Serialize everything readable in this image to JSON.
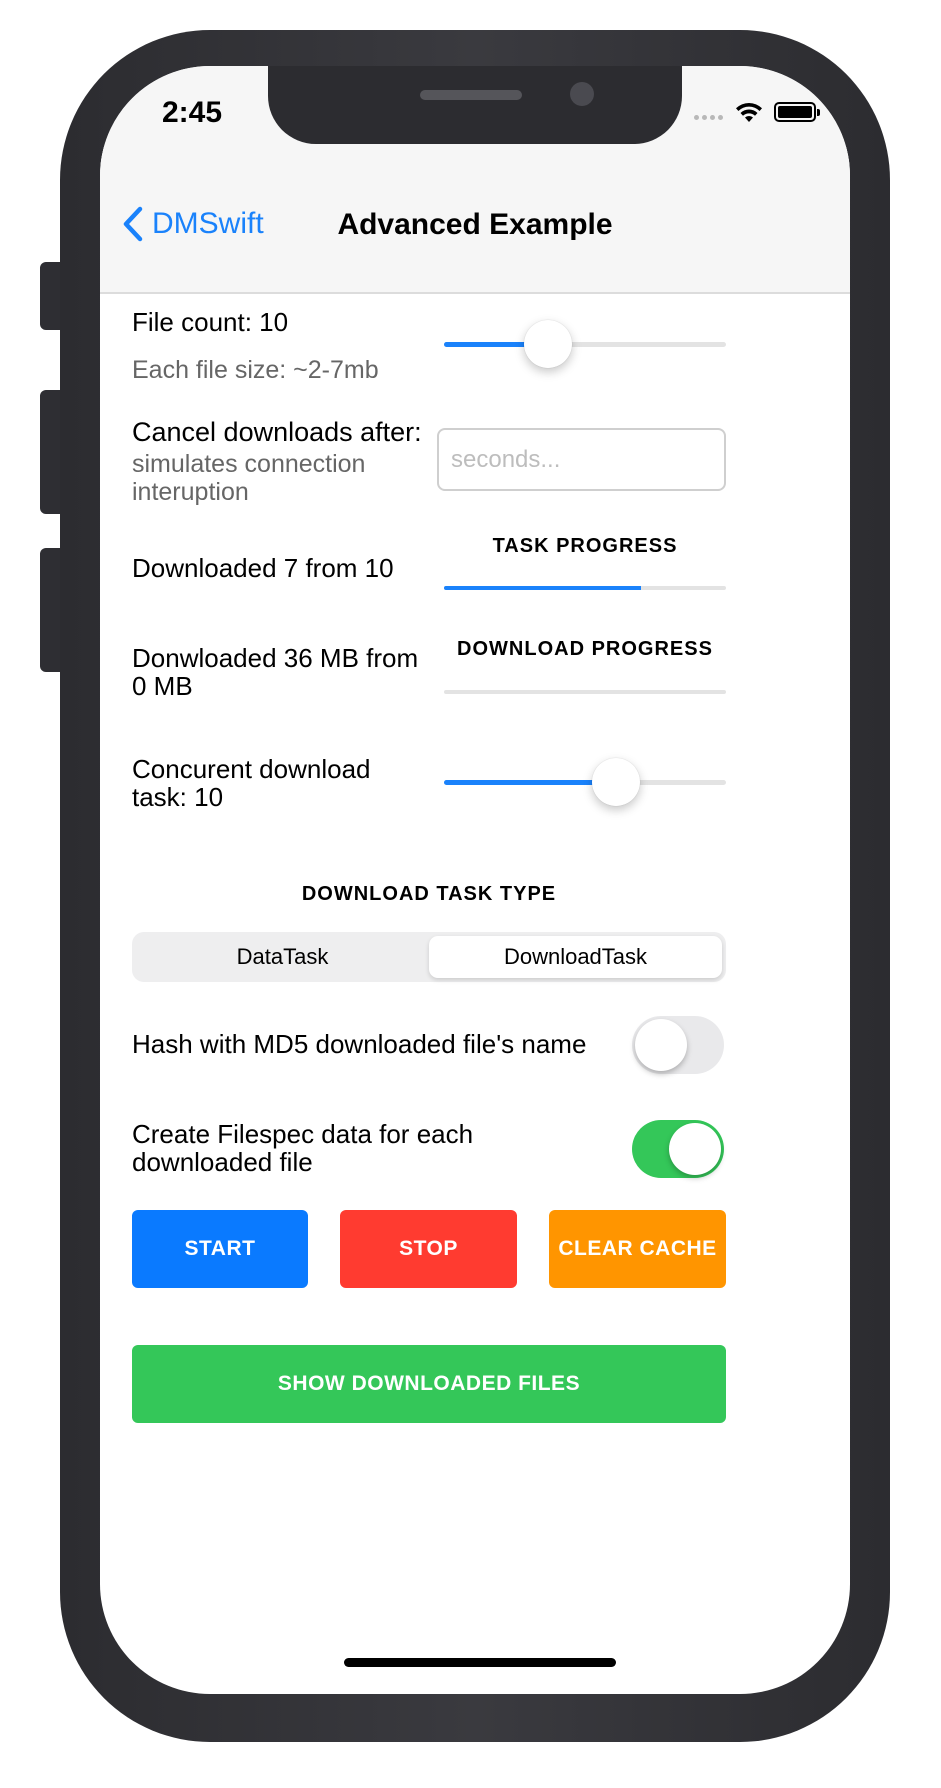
{
  "status": {
    "time": "2:45"
  },
  "nav": {
    "back_label": "DMSwift",
    "title": "Advanced Example"
  },
  "file_count": {
    "label": "File count: 10",
    "sublabel": "Each file size: ~2-7mb",
    "slider_value": 0.37
  },
  "cancel": {
    "label": "Cancel downloads after:",
    "sublabel_line1": "simulates connection",
    "sublabel_line2": "interuption",
    "placeholder": "seconds...",
    "value": ""
  },
  "task_progress": {
    "label": "Downloaded 7 from 10",
    "caption": "TASK PROGRESS",
    "value": 0.7
  },
  "download_progress": {
    "label_line1": "Donwloaded 36 MB from",
    "label_line2": "0 MB",
    "caption": "DOWNLOAD PROGRESS",
    "value": 0.0
  },
  "concurrent": {
    "label_line1": "Concurent download",
    "label_line2": "task: 10",
    "slider_value": 0.61
  },
  "task_type": {
    "caption": "DOWNLOAD TASK TYPE",
    "options": [
      "DataTask",
      "DownloadTask"
    ],
    "selected": "DownloadTask"
  },
  "md5": {
    "label": "Hash with MD5 downloaded file's name",
    "on": false
  },
  "filespec": {
    "label_line1": "Create Filespec data for each",
    "label_line2": "downloaded file",
    "on": true
  },
  "buttons": {
    "start": "START",
    "stop": "STOP",
    "clear": "CLEAR CACHE",
    "show": "SHOW DOWNLOADED FILES"
  },
  "colors": {
    "accent": "#1a82fb",
    "start": "#0a7aff",
    "stop": "#ff3b30",
    "clear": "#ff9500",
    "show": "#34c759",
    "toggle_on": "#34c759",
    "toggle_off": "#e9e9eb"
  }
}
